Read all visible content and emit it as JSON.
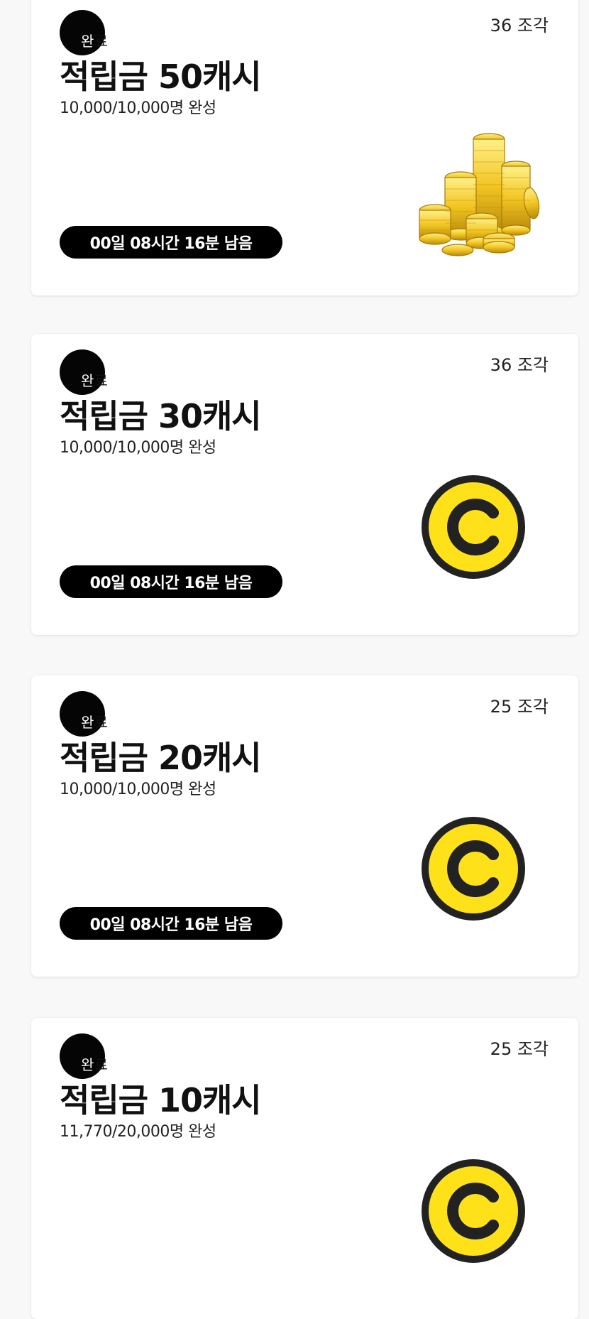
{
  "cards": [
    {
      "pieces": "36 조각",
      "badge": [
        "완",
        "료"
      ],
      "title": "적립금 50캐시",
      "progress": "10,000/10,000명 완성",
      "timer": "00일 08시간 16분 남음",
      "image": "coin-stack-icon"
    },
    {
      "pieces": "36 조각",
      "badge": [
        "완",
        "료"
      ],
      "title": "적립금 30캐시",
      "progress": "10,000/10,000명 완성",
      "timer": "00일 08시간 16분 남음",
      "image": "cash-c-coin-icon"
    },
    {
      "pieces": "25 조각",
      "badge": [
        "완",
        "료"
      ],
      "title": "적립금 20캐시",
      "progress": "10,000/10,000명 완성",
      "timer": "00일 08시간 16분 남음",
      "image": "cash-c-coin-icon"
    },
    {
      "pieces": "25 조각",
      "badge": [
        "완",
        "료"
      ],
      "title": "적립금 10캐시",
      "progress": "11,770/20,000명 완성",
      "image": "cash-c-coin-icon"
    }
  ],
  "colors": {
    "coin_yellow": "#FFE11A",
    "coin_ring": "#222222",
    "badge_bg": "#050505",
    "timer_bg": "#000000"
  }
}
